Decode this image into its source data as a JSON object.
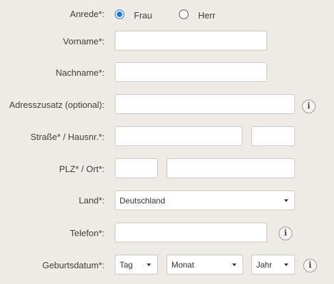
{
  "form": {
    "salutation": {
      "label": "Anrede*:",
      "options": [
        "Frau",
        "Herr"
      ],
      "selected": "Frau"
    },
    "first_name": {
      "label": "Vorname*:",
      "value": ""
    },
    "last_name": {
      "label": "Nachname*:",
      "value": ""
    },
    "address_extra": {
      "label": "Adresszusatz (optional):",
      "value": "",
      "info_icon": "info-icon"
    },
    "street": {
      "label": "Straße* / Hausnr.*:",
      "street_value": "",
      "house_no_value": ""
    },
    "postal": {
      "label": "PLZ* / Ort*:",
      "zip_value": "",
      "city_value": ""
    },
    "country": {
      "label": "Land*:",
      "selected": "Deutschland"
    },
    "phone": {
      "label": "Telefon*:",
      "value": "",
      "info_icon": "info-icon"
    },
    "birthdate": {
      "label": "Geburtsdatum*:",
      "day": "Tag",
      "month": "Monat",
      "year": "Jahr",
      "info_icon": "info-icon"
    },
    "info_glyph": "i",
    "colors": {
      "background": "#efebe7",
      "radio_accent": "#1a73e8",
      "field_border": "#c9c9c9"
    }
  }
}
